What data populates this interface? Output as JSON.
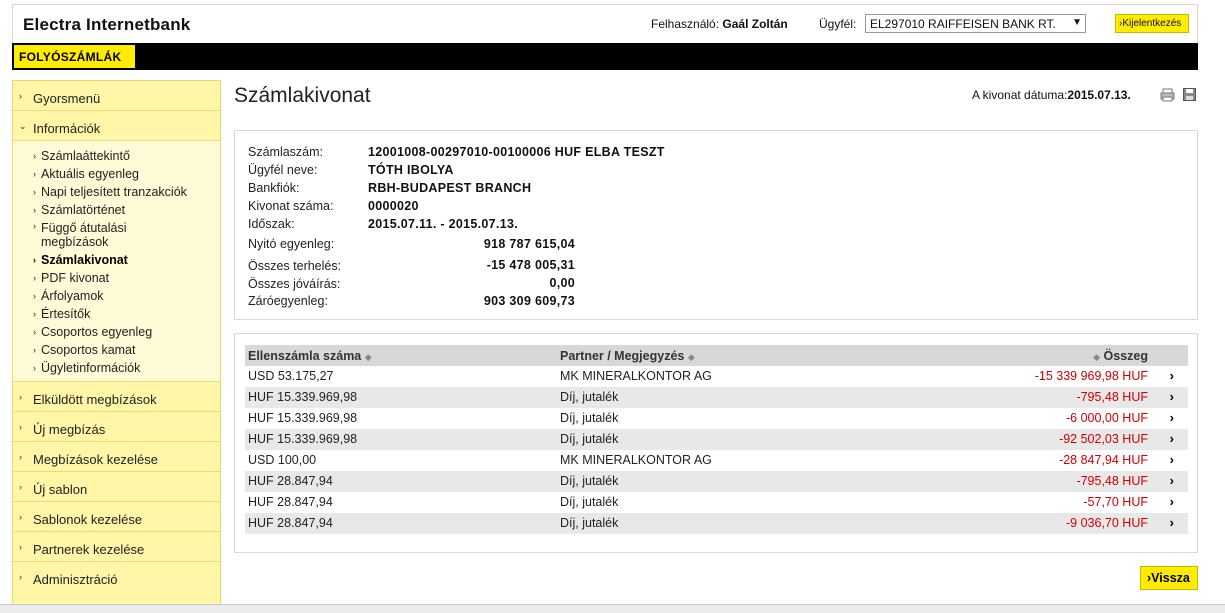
{
  "header": {
    "brand": "Electra Internetbank",
    "user_label": "Felhasználó:",
    "user_name": "Gaál Zoltán",
    "client_label": "Ügyfél:",
    "client_value": "EL297010 RAIFFEISEN BANK RT.",
    "logout_label": "Kijelentkezés"
  },
  "nav": {
    "tab": "FOLYÓSZÁMLÁK"
  },
  "sidebar": {
    "top_items": [
      "Gyorsmenü",
      "Információk"
    ],
    "sub_items": [
      "Számlaáttekintő",
      "Aktuális egyenleg",
      "Napi teljesített tranzakciók",
      "Számlatörténet",
      "Függő átutalási megbízások",
      "Számlakivonat",
      "PDF kivonat",
      "Árfolyamok",
      "Értesítők",
      "Csoportos egyenleg",
      "Csoportos kamat",
      "Ügyletinformációk"
    ],
    "bottom_items": [
      "Elküldött megbízások",
      "Új megbízás",
      "Megbízások kezelése",
      "Új sablon",
      "Sablonok kezelése",
      "Partnerek kezelése",
      "Adminisztráció"
    ]
  },
  "main": {
    "title": "Számlakivonat",
    "date_label": "A kivonat dátuma:",
    "date_value": "2015.07.13."
  },
  "info": {
    "account_label": "Számlaszám:",
    "account_value": "12001008-00297010-00100006 HUF ELBA TESZT",
    "client_label": "Ügyfél neve:",
    "client_value": "TÓTH IBOLYA",
    "branch_label": "Bankfiók:",
    "branch_value": "RBH-BUDAPEST BRANCH",
    "stmt_label": "Kivonat száma:",
    "stmt_value": "0000020",
    "period_label": "Időszak:",
    "period_value": "2015.07.11. - 2015.07.13.",
    "opening_label": "Nyitó egyenleg:",
    "opening_value": "918 787 615,04",
    "debit_label": "Összes terhelés:",
    "debit_value": "-15 478 005,31",
    "credit_label": "Összes jóváírás:",
    "credit_value": "0,00",
    "closing_label": "Záróegyenleg:",
    "closing_value": "903 309 609,73"
  },
  "table": {
    "col_account": "Ellenszámla száma",
    "col_partner": "Partner / Megjegyzés",
    "col_amount": "Összeg",
    "rows": [
      {
        "account": "USD 53.175,27",
        "partner": "MK MINERALKONTOR AG",
        "amount": "-15 339 969,98 HUF"
      },
      {
        "account": "HUF 15.339.969,98",
        "partner": "Díj, jutalék",
        "amount": "-795,48 HUF"
      },
      {
        "account": "HUF 15.339.969,98",
        "partner": "Díj, jutalék",
        "amount": "-6 000,00 HUF"
      },
      {
        "account": "HUF 15.339.969,98",
        "partner": "Díj, jutalék",
        "amount": "-92 502,03 HUF"
      },
      {
        "account": "USD 100,00",
        "partner": "MK MINERALKONTOR AG",
        "amount": "-28 847,94 HUF"
      },
      {
        "account": "HUF 28.847,94",
        "partner": "Díj, jutalék",
        "amount": "-795,48 HUF"
      },
      {
        "account": "HUF 28.847,94",
        "partner": "Díj, jutalék",
        "amount": "-57,70 HUF"
      },
      {
        "account": "HUF 28.847,94",
        "partner": "Díj, jutalék",
        "amount": "-9 036,70 HUF"
      }
    ]
  },
  "back_label": "Vissza"
}
